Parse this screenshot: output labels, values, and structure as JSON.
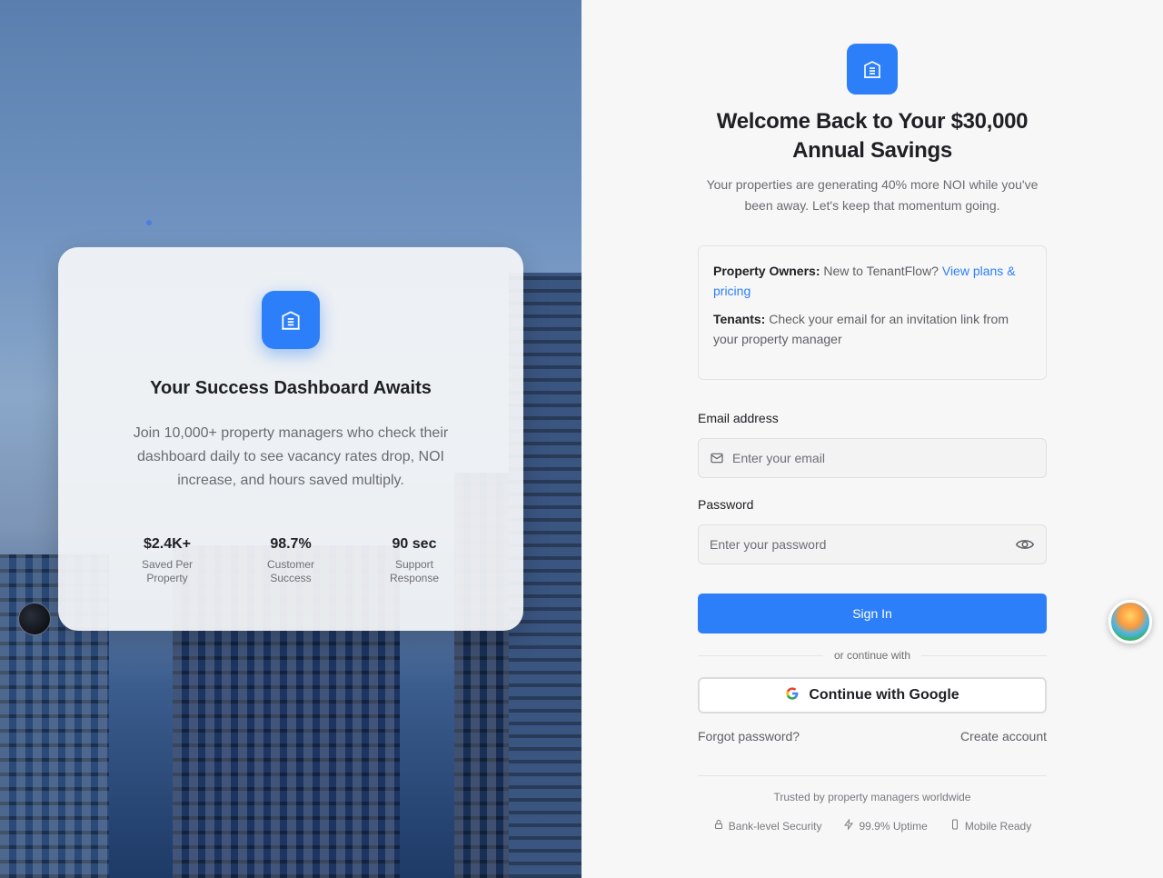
{
  "hero": {
    "card": {
      "title": "Your Success Dashboard Awaits",
      "description": "Join 10,000+ property managers who check their dashboard daily to see vacancy rates drop, NOI increase, and hours saved multiply.",
      "stats": [
        {
          "value": "$2.4K+",
          "label": "Saved Per Property"
        },
        {
          "value": "98.7%",
          "label": "Customer Success"
        },
        {
          "value": "90 sec",
          "label": "Support Response"
        }
      ]
    }
  },
  "login": {
    "title": "Welcome Back to Your $30,000 Annual Savings",
    "subtitle": "Your properties are generating 40% more NOI while you've been away. Let's keep that momentum going.",
    "info": {
      "owners_label": "Property Owners:",
      "owners_text": "New to TenantFlow?",
      "owners_link": "View plans & pricing",
      "tenants_label": "Tenants:",
      "tenants_text": "Check your email for an invitation link from your property manager"
    },
    "email": {
      "label": "Email address",
      "placeholder": "Enter your email",
      "value": ""
    },
    "password": {
      "label": "Password",
      "placeholder": "Enter your password",
      "value": ""
    },
    "signin_label": "Sign In",
    "divider_text": "or continue with",
    "google_label": "Continue with Google",
    "forgot_label": "Forgot password?",
    "create_label": "Create account",
    "trusted_text": "Trusted by property managers worldwide",
    "badges": [
      {
        "icon": "lock-icon",
        "label": "Bank-level Security"
      },
      {
        "icon": "bolt-icon",
        "label": "99.9% Uptime"
      },
      {
        "icon": "phone-icon",
        "label": "Mobile Ready"
      }
    ]
  },
  "colors": {
    "accent": "#2d7ff9",
    "text": "#1f1f24",
    "muted": "#6b6b72",
    "background": "#f7f7f7"
  }
}
